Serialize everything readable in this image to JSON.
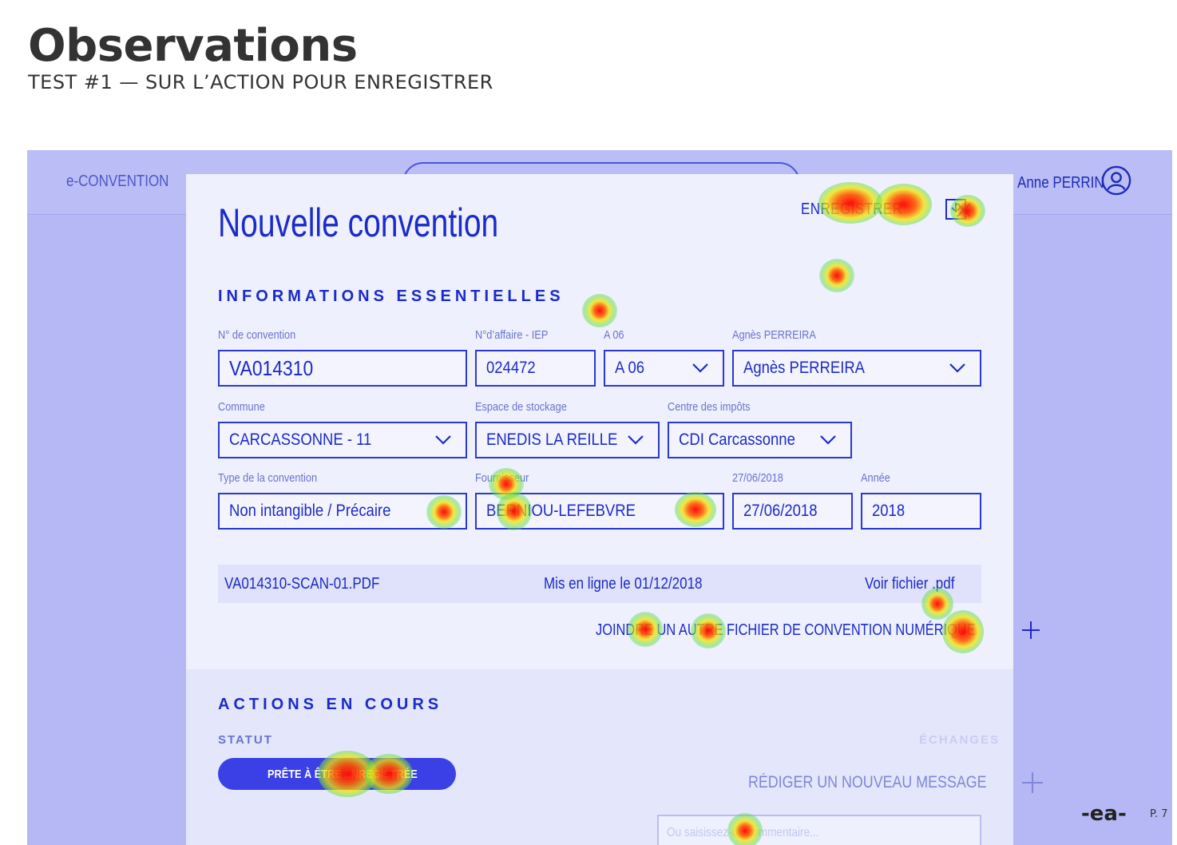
{
  "slide": {
    "title": "Observations",
    "subtitle": "TEST #1 — SUR L’ACTION POUR ENREGISTRER",
    "logo": "-ea-",
    "page": "P. 7"
  },
  "app": {
    "name": "e-CONVENTION",
    "user_name": "Anne PERRIN",
    "accent": "#1b2bc8",
    "background": "#b5b8f5"
  },
  "modal": {
    "title": "Nouvelle convention",
    "save_label": "ENREGISTRER",
    "section_essentials": "INFORMATIONS ESSENTIELLES",
    "fields": {
      "convention_no": {
        "label": "N° de convention",
        "value": "VA014310"
      },
      "affaire": {
        "label": "N°d’affaire - IEP",
        "value": "024472"
      },
      "a06": {
        "label": "A 06",
        "value": "A 06"
      },
      "agent": {
        "label": "Agnès PERREIRA",
        "value": "Agnès PERREIRA"
      },
      "commune": {
        "label": "Commune",
        "value": "CARCASSONNE - 11"
      },
      "stockage": {
        "label": "Espace de stockage",
        "value": "ENEDIS LA REILLE"
      },
      "impots": {
        "label": "Centre des impôts",
        "value": "CDI Carcassonne"
      },
      "type": {
        "label": "Type de la convention",
        "value": "Non intangible / Précaire"
      },
      "fournisseur": {
        "label": "Fournisseur",
        "value": "BERNIOU-LEFEBVRE"
      },
      "date": {
        "label": "27/06/2018",
        "value": "27/06/2018"
      },
      "annee": {
        "label": "Année",
        "value": "2018"
      }
    },
    "file": {
      "name": "VA014310-SCAN-01.PDF",
      "uploaded": "Mis en ligne le 01/12/2018",
      "view": "Voir fichier .pdf"
    },
    "attach_label": "JOINDRE UN AUTRE FICHIER DE CONVENTION NUMÉRIQUE",
    "section_actions": "ACTIONS EN COURS",
    "statut_label": "STATUT",
    "echanges_label": "ÉCHANGES",
    "status_value": "PRÊTE À ÊTRE ENREGISTRÉE",
    "new_message": "RÉDIGER UN NOUVEAU MESSAGE",
    "comment_placeholder": "Ou saisissez-un commentaire..."
  }
}
